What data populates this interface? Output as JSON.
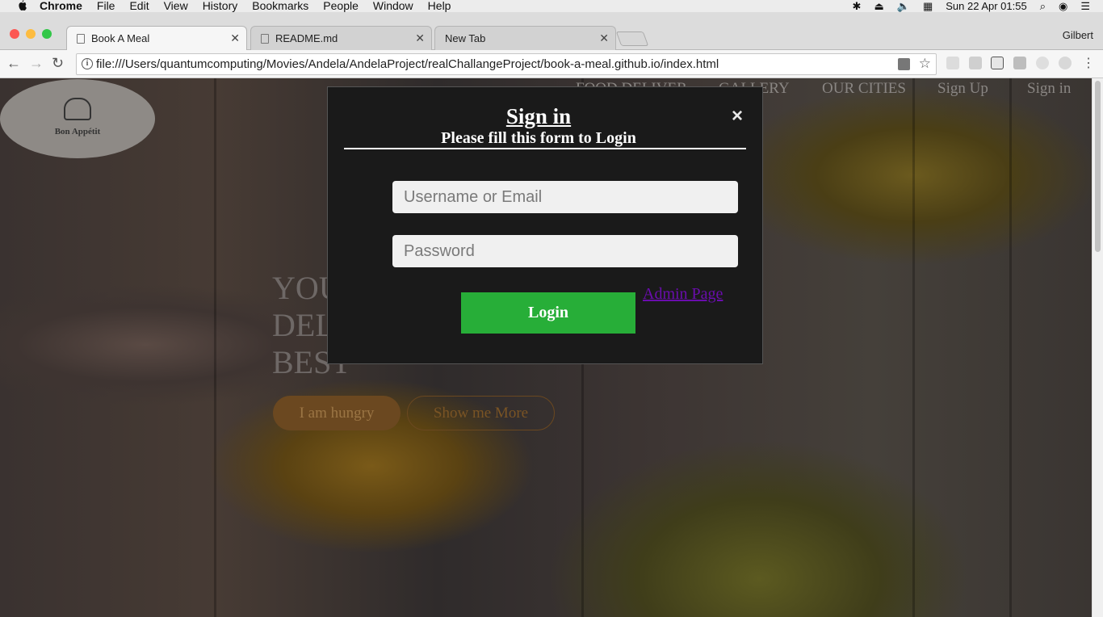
{
  "menubar": {
    "app": "Chrome",
    "items": [
      "File",
      "Edit",
      "View",
      "History",
      "Bookmarks",
      "People",
      "Window",
      "Help"
    ],
    "clock": "Sun 22 Apr  01:55"
  },
  "browser": {
    "tabs": [
      {
        "title": "Book A Meal",
        "active": true
      },
      {
        "title": "README.md",
        "active": false
      },
      {
        "title": "New Tab",
        "active": false
      }
    ],
    "profile": "Gilbert",
    "url": "file:///Users/quantumcomputing/Movies/Andela/AndelaProject/realChallangeProject/book-a-meal.github.io/index.html"
  },
  "site": {
    "logo": {
      "brand": "Bon Appétit"
    },
    "nav": [
      "FOOD DELIVER",
      "GALLERY",
      "OUR CITIES",
      "Sign Up",
      "Sign in"
    ],
    "hero_text": "YOU ORDER, WE DELIVER.BECAUSE WE ARE THE BEST",
    "hungry_button": "I am hungry",
    "more_button": "Show me More"
  },
  "modal": {
    "title": "Sign in",
    "subtitle": "Please fill this form to Login",
    "close": "×",
    "username_placeholder": "Username or Email",
    "password_placeholder": "Password",
    "login_button": "Login",
    "admin_link": "Admin Page"
  },
  "colors": {
    "login_green": "#27ae38",
    "admin_link": "#6a0dad",
    "modal_bg": "#1a1a1a"
  }
}
